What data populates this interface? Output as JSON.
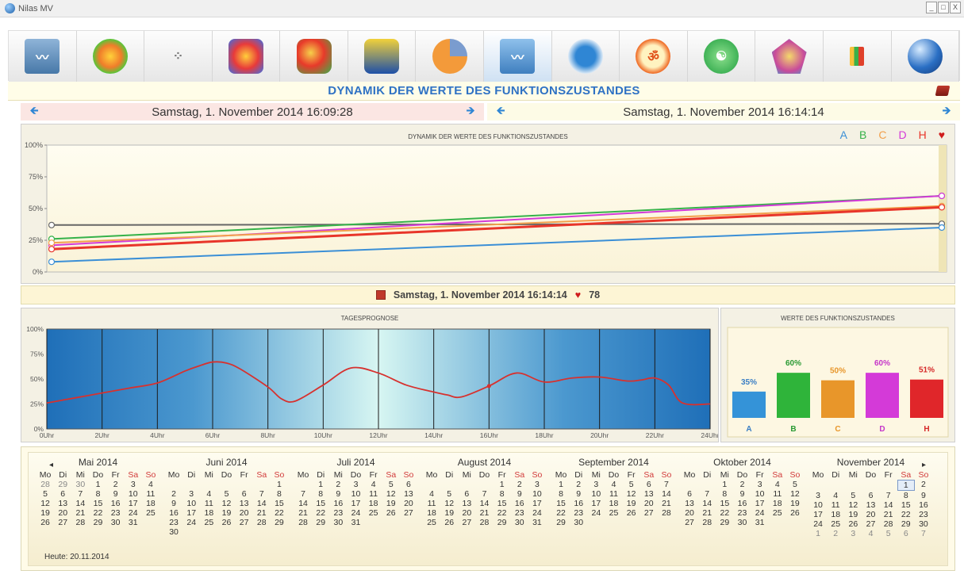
{
  "window": {
    "title": "Nilas MV",
    "buttons": [
      "_",
      "□",
      "X"
    ]
  },
  "toolbar": {
    "items": [
      {
        "name": "heartbeat-icon",
        "active": false
      },
      {
        "name": "heatmap-sphere-icon",
        "active": false
      },
      {
        "name": "scatter-icon",
        "active": false
      },
      {
        "name": "hexagon-cluster-icon",
        "active": false
      },
      {
        "name": "topo-map-icon",
        "active": false
      },
      {
        "name": "body-scan-icon",
        "active": false
      },
      {
        "name": "pie-icon",
        "active": false
      },
      {
        "name": "wave-chart-icon",
        "active": true
      },
      {
        "name": "head-profile-icon",
        "active": false
      },
      {
        "name": "om-icon",
        "active": false
      },
      {
        "name": "yin-yang-icon",
        "active": false
      },
      {
        "name": "pentagon-icon",
        "active": false
      },
      {
        "name": "bar-chart-icon",
        "active": false
      },
      {
        "name": "globe-icon",
        "active": false
      }
    ]
  },
  "header": {
    "title": "DYNAMIK DER WERTE DES FUNKTIONSZUSTANDES"
  },
  "nav": {
    "left_date": "Samstag, 1. November 2014 16:09:28",
    "right_date": "Samstag, 1. November 2014 16:14:14"
  },
  "mid": {
    "date": "Samstag, 1. November 2014 16:14:14",
    "heart": "78"
  },
  "chart_data": [
    {
      "type": "line",
      "title": "DYNAMIK DER WERTE DES FUNKTIONSZUSTANDES",
      "y_ticks": [
        "0%",
        "25%",
        "50%",
        "75%",
        "100%"
      ],
      "ylim": [
        0,
        100
      ],
      "x": [
        0,
        1
      ],
      "series": [
        {
          "name": "A",
          "color": "#3b8fd6",
          "values": [
            8,
            35
          ]
        },
        {
          "name": "B",
          "color": "#36b24a",
          "values": [
            26,
            60
          ]
        },
        {
          "name": "C",
          "color": "#f2a04c",
          "values": [
            23,
            52
          ]
        },
        {
          "name": "D",
          "color": "#d43ad8",
          "values": [
            21,
            60
          ]
        },
        {
          "name": "H",
          "color": "#e8352a",
          "values": [
            18,
            51
          ]
        },
        {
          "name": "heart",
          "color": "#666666",
          "values": [
            37,
            38
          ]
        }
      ],
      "legend": {
        "labels": [
          "A",
          "B",
          "C",
          "D",
          "H"
        ],
        "position": "top-right"
      }
    },
    {
      "type": "line",
      "title": "TAGESPROGNOSE",
      "y_ticks": [
        "0%",
        "25%",
        "50%",
        "75%",
        "100%"
      ],
      "ylim": [
        0,
        100
      ],
      "x_ticks": [
        "0Uhr",
        "2Uhr",
        "4Uhr",
        "6Uhr",
        "8Uhr",
        "10Uhr",
        "12Uhr",
        "14Uhr",
        "16Uhr",
        "18Uhr",
        "20Uhr",
        "22Uhr",
        "24Uhr"
      ],
      "xlim": [
        0,
        24
      ],
      "x": [
        0,
        1,
        2,
        3,
        4,
        5,
        5.5,
        6,
        6.5,
        7,
        8,
        8.5,
        9,
        10,
        11,
        12,
        13,
        14,
        14.5,
        15,
        16,
        17,
        18,
        19,
        20,
        21,
        21.5,
        22,
        22.5,
        23,
        24
      ],
      "values": [
        26,
        31,
        36,
        41,
        46,
        58,
        63,
        67,
        66,
        60,
        42,
        30,
        28,
        44,
        61,
        56,
        44,
        37,
        34,
        32,
        43,
        56,
        47,
        51,
        52,
        48,
        49,
        51,
        44,
        26,
        25
      ],
      "color": "#d7312e",
      "marker": {
        "x": 16,
        "y": 43
      }
    },
    {
      "type": "bar",
      "title": "WERTE DES FUNKTIONSZUSTANDES",
      "categories": [
        "A",
        "B",
        "C",
        "D",
        "H"
      ],
      "values": [
        35,
        60,
        50,
        60,
        51
      ],
      "labels": [
        "35%",
        "60%",
        "50%",
        "60%",
        "51%"
      ],
      "colors": [
        "#3493d8",
        "#2fb43a",
        "#e8962a",
        "#d43ad8",
        "#e0262a"
      ],
      "label_colors": [
        "#3b7fc4",
        "#2a9a34",
        "#e8962a",
        "#c536c9",
        "#d62828"
      ],
      "ylim": [
        0,
        100
      ]
    }
  ],
  "calendar": {
    "months": [
      {
        "title": "Mai 2014",
        "weeks": [
          [
            "28",
            "29",
            "30",
            "1",
            "2",
            "3",
            "4"
          ],
          [
            "5",
            "6",
            "7",
            "8",
            "9",
            "10",
            "11"
          ],
          [
            "12",
            "13",
            "14",
            "15",
            "16",
            "17",
            "18"
          ],
          [
            "19",
            "20",
            "21",
            "22",
            "23",
            "24",
            "25"
          ],
          [
            "26",
            "27",
            "28",
            "29",
            "30",
            "31",
            ""
          ]
        ],
        "other": [
          [
            0,
            0
          ],
          [
            0,
            1
          ],
          [
            0,
            2
          ]
        ]
      },
      {
        "title": "Juni 2014",
        "weeks": [
          [
            "",
            "",
            "",
            "",
            "",
            "",
            "1"
          ],
          [
            "2",
            "3",
            "4",
            "5",
            "6",
            "7",
            "8"
          ],
          [
            "9",
            "10",
            "11",
            "12",
            "13",
            "14",
            "15"
          ],
          [
            "16",
            "17",
            "18",
            "19",
            "20",
            "21",
            "22"
          ],
          [
            "23",
            "24",
            "25",
            "26",
            "27",
            "28",
            "29"
          ],
          [
            "30",
            "",
            "",
            "",
            "",
            "",
            ""
          ]
        ],
        "other": []
      },
      {
        "title": "Juli 2014",
        "weeks": [
          [
            "",
            "1",
            "2",
            "3",
            "4",
            "5",
            "6"
          ],
          [
            "7",
            "8",
            "9",
            "10",
            "11",
            "12",
            "13"
          ],
          [
            "14",
            "15",
            "16",
            "17",
            "18",
            "19",
            "20"
          ],
          [
            "21",
            "22",
            "23",
            "24",
            "25",
            "26",
            "27"
          ],
          [
            "28",
            "29",
            "30",
            "31",
            "",
            "",
            ""
          ]
        ],
        "other": []
      },
      {
        "title": "August 2014",
        "weeks": [
          [
            "",
            "",
            "",
            "",
            "1",
            "2",
            "3"
          ],
          [
            "4",
            "5",
            "6",
            "7",
            "8",
            "9",
            "10"
          ],
          [
            "11",
            "12",
            "13",
            "14",
            "15",
            "16",
            "17"
          ],
          [
            "18",
            "19",
            "20",
            "21",
            "22",
            "23",
            "24"
          ],
          [
            "25",
            "26",
            "27",
            "28",
            "29",
            "30",
            "31"
          ]
        ],
        "other": []
      },
      {
        "title": "September 2014",
        "weeks": [
          [
            "1",
            "2",
            "3",
            "4",
            "5",
            "6",
            "7"
          ],
          [
            "8",
            "9",
            "10",
            "11",
            "12",
            "13",
            "14"
          ],
          [
            "15",
            "16",
            "17",
            "18",
            "19",
            "20",
            "21"
          ],
          [
            "22",
            "23",
            "24",
            "25",
            "26",
            "27",
            "28"
          ],
          [
            "29",
            "30",
            "",
            "",
            "",
            "",
            ""
          ]
        ],
        "other": []
      },
      {
        "title": "Oktober 2014",
        "weeks": [
          [
            "",
            "",
            "1",
            "2",
            "3",
            "4",
            "5"
          ],
          [
            "6",
            "7",
            "8",
            "9",
            "10",
            "11",
            "12"
          ],
          [
            "13",
            "14",
            "15",
            "16",
            "17",
            "18",
            "19"
          ],
          [
            "20",
            "21",
            "22",
            "23",
            "24",
            "25",
            "26"
          ],
          [
            "27",
            "28",
            "29",
            "30",
            "31",
            "",
            ""
          ]
        ],
        "other": []
      },
      {
        "title": "November 2014",
        "weeks": [
          [
            "",
            "",
            "",
            "",
            "",
            "1",
            "2"
          ],
          [
            "3",
            "4",
            "5",
            "6",
            "7",
            "8",
            "9"
          ],
          [
            "10",
            "11",
            "12",
            "13",
            "14",
            "15",
            "16"
          ],
          [
            "17",
            "18",
            "19",
            "20",
            "21",
            "22",
            "23"
          ],
          [
            "24",
            "25",
            "26",
            "27",
            "28",
            "29",
            "30"
          ],
          [
            "1",
            "2",
            "3",
            "4",
            "5",
            "6",
            "7"
          ]
        ],
        "other": [
          [
            5,
            0
          ],
          [
            5,
            1
          ],
          [
            5,
            2
          ],
          [
            5,
            3
          ],
          [
            5,
            4
          ],
          [
            5,
            5
          ],
          [
            5,
            6
          ]
        ],
        "selected": [
          0,
          5
        ]
      }
    ],
    "weekdays": [
      "Mo",
      "Di",
      "Mi",
      "Do",
      "Fr",
      "Sa",
      "So"
    ],
    "prev": "◂",
    "next": "▸",
    "today": "Heute: 20.11.2014"
  }
}
